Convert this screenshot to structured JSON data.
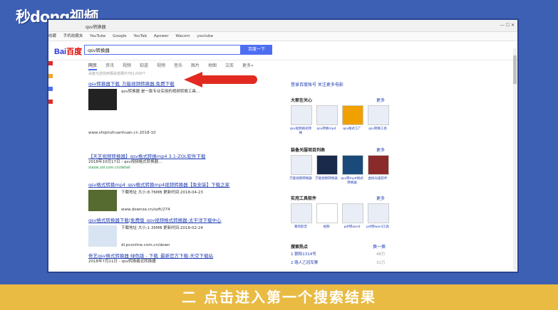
{
  "brand": {
    "logo_text": "秒dong视频"
  },
  "browser": {
    "address": "qsv转换器",
    "bookmarks": [
      "收藏",
      "手机收藏夹",
      "YouTube",
      "Google",
      "YouTab",
      "Apower",
      "Wacom",
      "youtube"
    ]
  },
  "search": {
    "brand": "Bai",
    "brand2": "百度",
    "query": "qsv转换器",
    "button": "百度一下"
  },
  "tabs": [
    "网页",
    "资讯",
    "视频",
    "知道",
    "视频",
    "音乐",
    "图片",
    "地图",
    "文库",
    "更多»"
  ],
  "stats": "百度为您找到相关结果约762,000个",
  "results": [
    {
      "title": "qsv转换器下载_万能视频转换器,免费下载",
      "snippet": "qsv转换器 是一款专业实用的视频转换工具…",
      "url": "www.shipinzhuanhuan.cn 2018-10"
    },
    {
      "title": "【天艺视频转换器】qsv格式转换mp4 3.1-ZOL软件下载",
      "snippet": "2018年10月17日 - qsv视频格式转换器…",
      "url": "xiazai.zol.com.cn/detail"
    },
    {
      "title": "qsv格式转换mp4_qsv格式转换mp4视频转换器【免安装】下载之家",
      "snippet": "下载地址 大小:8.76MB 更新时间:2018-04-23",
      "url": "www.downza.cn/soft/274"
    },
    {
      "title": "qsv格式转换器下载|免费版_qsv视频格式转换器-太平洋下载中心",
      "snippet": "下载地址 大小:1.35MB 更新时间:2018-02-24",
      "url": "dl.pconline.com.cn/down"
    },
    {
      "title": "奇艺qsv格式转换器 绿色版 - 下载_最新官方下载-天空下载站",
      "snippet": "2018年7月11日 - qsv转换格式转换器",
      "url": ""
    }
  ],
  "sidebar": {
    "login": "登录百度账号 关注更多电影",
    "s1": "大家在关心",
    "s2": "装备关服项目列表",
    "s3": "实用工具软件",
    "s4": "搜索热点",
    "more": "更多",
    "g1": [
      "qsv视频格式转换",
      "qsv转换mp4",
      "qsv格式工厂",
      "qsv转换工具"
    ],
    "g2": [
      "万能视频转换器",
      "万能视频转换器",
      "qsv转mp4格式转换器",
      "虚拟光驱软件"
    ],
    "g3": [
      "暴风影音",
      "视频",
      "pdf转word",
      "pdf转word工具"
    ],
    "hot": [
      "1 朝阳1314号",
      "2 路人乙冠军赛"
    ],
    "hotv": [
      "48万",
      "31万"
    ],
    "more2": "换一换"
  },
  "caption": "二 点击进入第一个搜索结果"
}
